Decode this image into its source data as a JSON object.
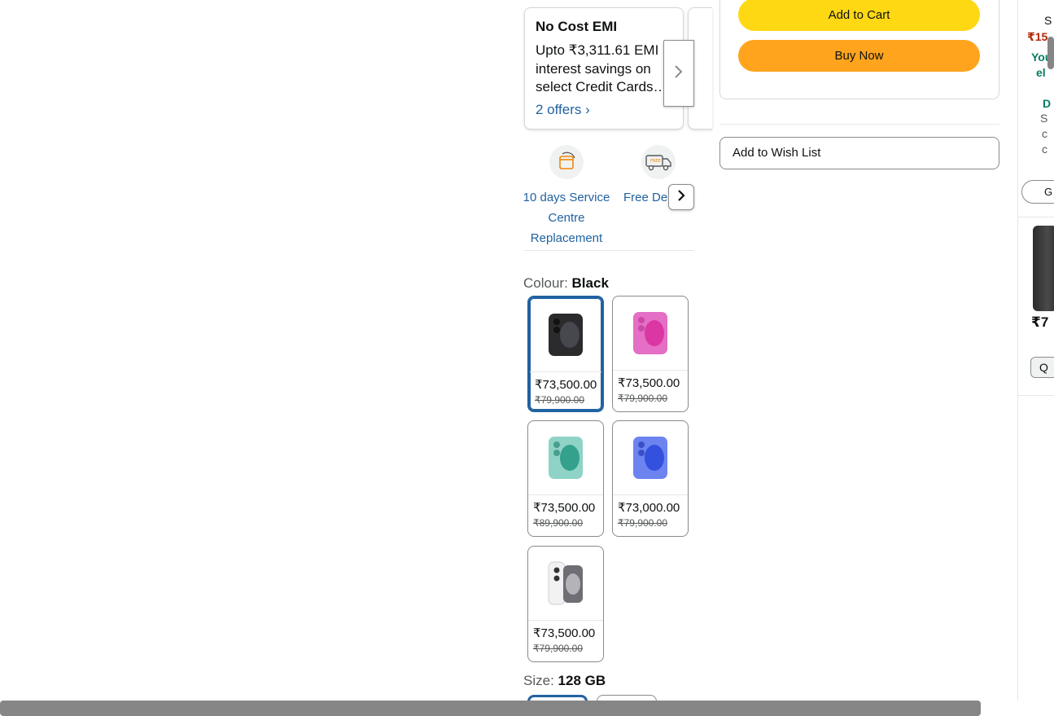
{
  "offers": {
    "card_title": "No Cost EMI",
    "card_body": "Upto ₹3,311.61 EMI interest savings on select Credit Cards…",
    "card_link": "2 offers ›"
  },
  "features": {
    "items": [
      {
        "label": "10 days Service Centre Replacement",
        "icon": "service-replacement-icon"
      },
      {
        "label": "Free Deli",
        "icon": "free-delivery-icon"
      }
    ]
  },
  "colour": {
    "label": "Colour: ",
    "selected": "Black",
    "options": [
      {
        "name": "Black",
        "price": "₹73,500.00",
        "mrp": "₹79,900.00",
        "color": "#3a3a3c"
      },
      {
        "name": "Pink",
        "price": "₹73,500.00",
        "mrp": "₹79,900.00",
        "color": "#e46fc4"
      },
      {
        "name": "Teal",
        "price": "₹73,500.00",
        "mrp": "₹89,900.00",
        "color": "#2fa08c"
      },
      {
        "name": "Ultramarine",
        "price": "₹73,000.00",
        "mrp": "₹79,900.00",
        "color": "#4c63e0"
      },
      {
        "name": "White",
        "price": "₹73,500.00",
        "mrp": "₹79,900.00",
        "color": "#e9e9eb"
      }
    ]
  },
  "size": {
    "label": "Size: ",
    "selected": "128 GB"
  },
  "buybox": {
    "add_to_cart": "Add to Cart",
    "buy_now": "Buy Now",
    "wish_list": "Add to Wish List"
  },
  "right_panel": {
    "s": "S",
    "price_partial": "₹15",
    "you_partial": "You",
    "el_partial": "el",
    "d_partial": "D",
    "s2": "S",
    "c1": "c",
    "c2": "c",
    "btn_partial": "G",
    "price2_partial": "₹7",
    "qty_partial": "Q"
  }
}
